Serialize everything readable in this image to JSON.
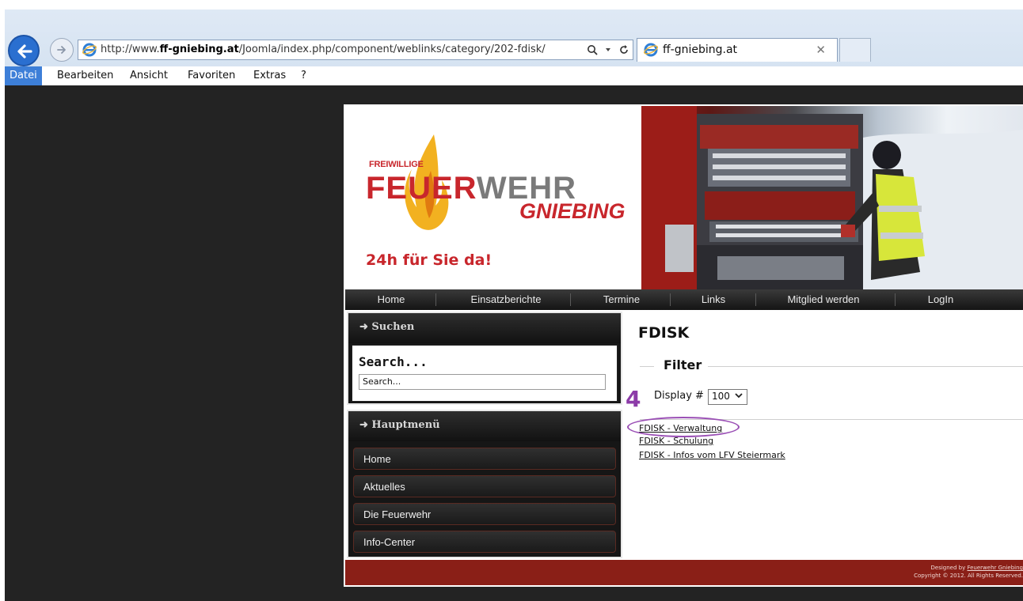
{
  "browser": {
    "url_prefix": "http://www.",
    "url_domain": "ff-gniebing.at",
    "url_path": "/Joomla/index.php/component/weblinks/category/202-fdisk/",
    "tab_title": "ff-gniebing.at",
    "menu": [
      "Datei",
      "Bearbeiten",
      "Ansicht",
      "Favoriten",
      "Extras",
      "?"
    ]
  },
  "site": {
    "logo": {
      "small": "FREIWILLIGE",
      "big_red": "FEUER",
      "big_gray": "WEHR",
      "sub": "GNIEBING",
      "tagline": "24h für Sie da!"
    },
    "topnav": [
      "Home",
      "Einsatzberichte",
      "Termine",
      "Links",
      "Mitglied werden",
      "LogIn"
    ],
    "search_panel": {
      "title": "➜ Suchen",
      "label": "Search...",
      "placeholder": "Search..."
    },
    "main_menu": {
      "title": "➜ Hauptmenü",
      "items": [
        "Home",
        "Aktuelles",
        "Die Feuerwehr",
        "Info-Center"
      ]
    },
    "content": {
      "title": "FDISK",
      "filter_legend": "Filter",
      "display_label": "Display #",
      "display_value": "100",
      "step_marker": "4",
      "links": [
        "FDISK - Verwaltung",
        "FDISK - Schulung",
        "FDISK - Infos vom LFV Steiermark"
      ]
    },
    "footer": {
      "line1_prefix": "Designed by ",
      "line1_link": "Feuerwehr Gniebing",
      "line2": "Copyright © 2012. All Rights Reserved."
    }
  },
  "colors": {
    "brand_red": "#c8262c",
    "footer_red": "#8a1f17",
    "annotation_purple": "#8c3ba8"
  }
}
